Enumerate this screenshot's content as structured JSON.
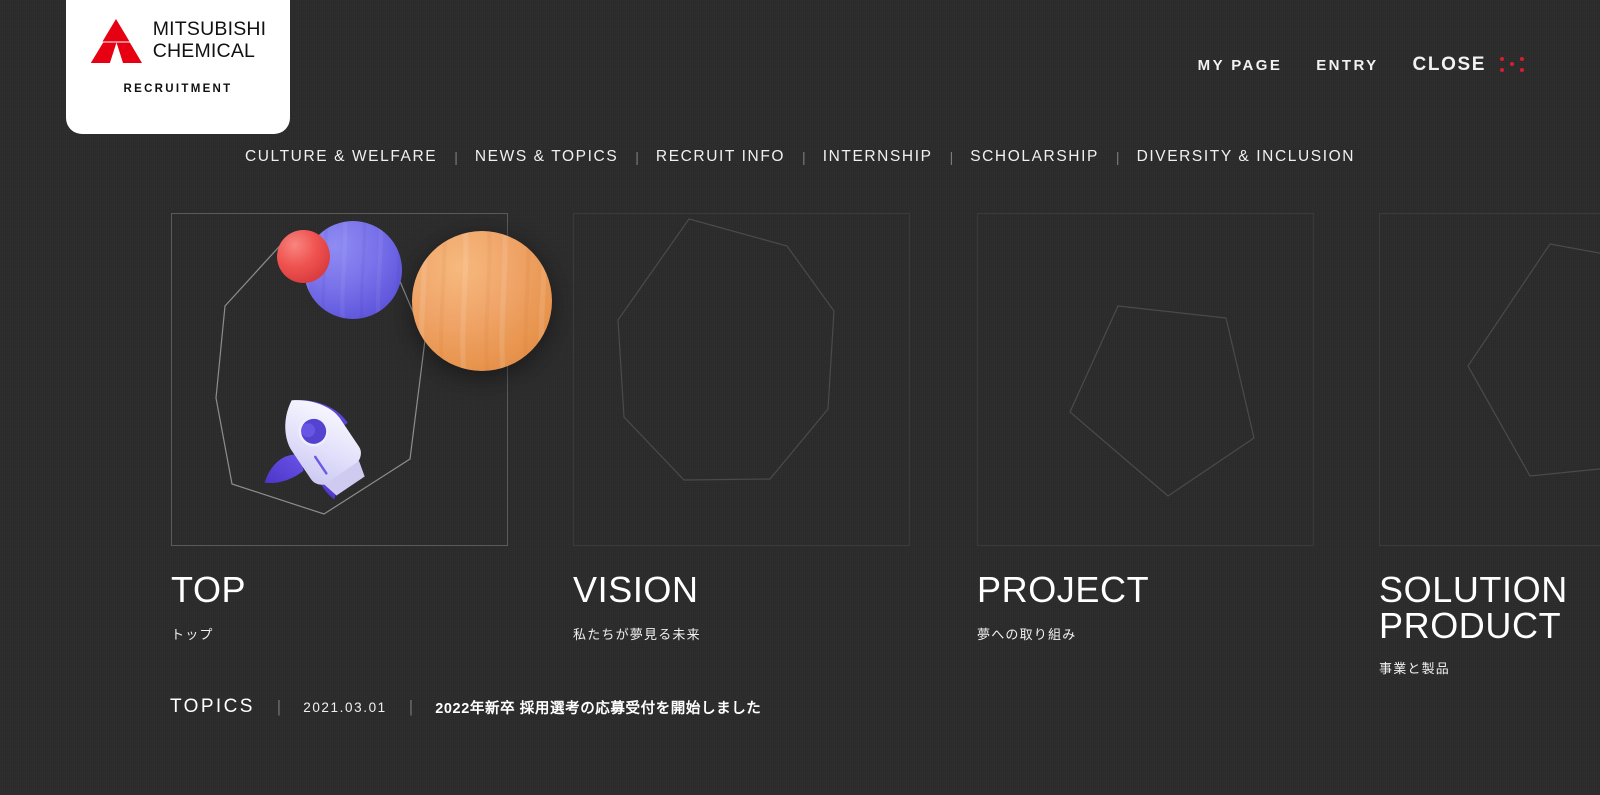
{
  "theme": {
    "background": "#2b2b2b",
    "text": "#ffffff",
    "accent_red": "#d7202f",
    "frame_border": "#5a5a5a",
    "frame_border_dim": "#3a3a3a"
  },
  "logo": {
    "mark_name": "mitsubishi-three-diamonds",
    "mark_color": "#e60012",
    "name": "MITSUBISHI\nCHEMICAL",
    "subtitle": "RECRUITMENT"
  },
  "util_nav": {
    "items": [
      {
        "label": "MY PAGE",
        "name": "my-page"
      },
      {
        "label": "ENTRY",
        "name": "entry"
      }
    ],
    "close": {
      "label": "CLOSE",
      "icon": "close-dots-icon"
    }
  },
  "main_nav": {
    "separator": "|",
    "items": [
      {
        "label": "CULTURE & WELFARE"
      },
      {
        "label": "NEWS & TOPICS"
      },
      {
        "label": "RECRUIT INFO"
      },
      {
        "label": "INTERNSHIP"
      },
      {
        "label": "SCHOLARSHIP"
      },
      {
        "label": "DIVERSITY & INCLUSION"
      }
    ]
  },
  "cards": [
    {
      "title": "TOP",
      "subtitle": "トップ",
      "shape": "octagon",
      "active": true,
      "illustration": "space-rocket-planets"
    },
    {
      "title": "VISION",
      "subtitle": "私たちが夢見る未来",
      "shape": "octagon",
      "active": false,
      "illustration": ""
    },
    {
      "title": "PROJECT",
      "subtitle": "夢への取り組み",
      "shape": "pentagon",
      "active": false,
      "illustration": ""
    },
    {
      "title": "SOLUTION\nPRODUCT",
      "subtitle": "事業と製品",
      "shape": "hexagon",
      "active": false,
      "illustration": ""
    }
  ],
  "topics": {
    "label": "TOPICS",
    "separator": "|",
    "date": "2021.03.01",
    "headline": "2022年新卒 採用選考の応募受付を開始しました"
  }
}
